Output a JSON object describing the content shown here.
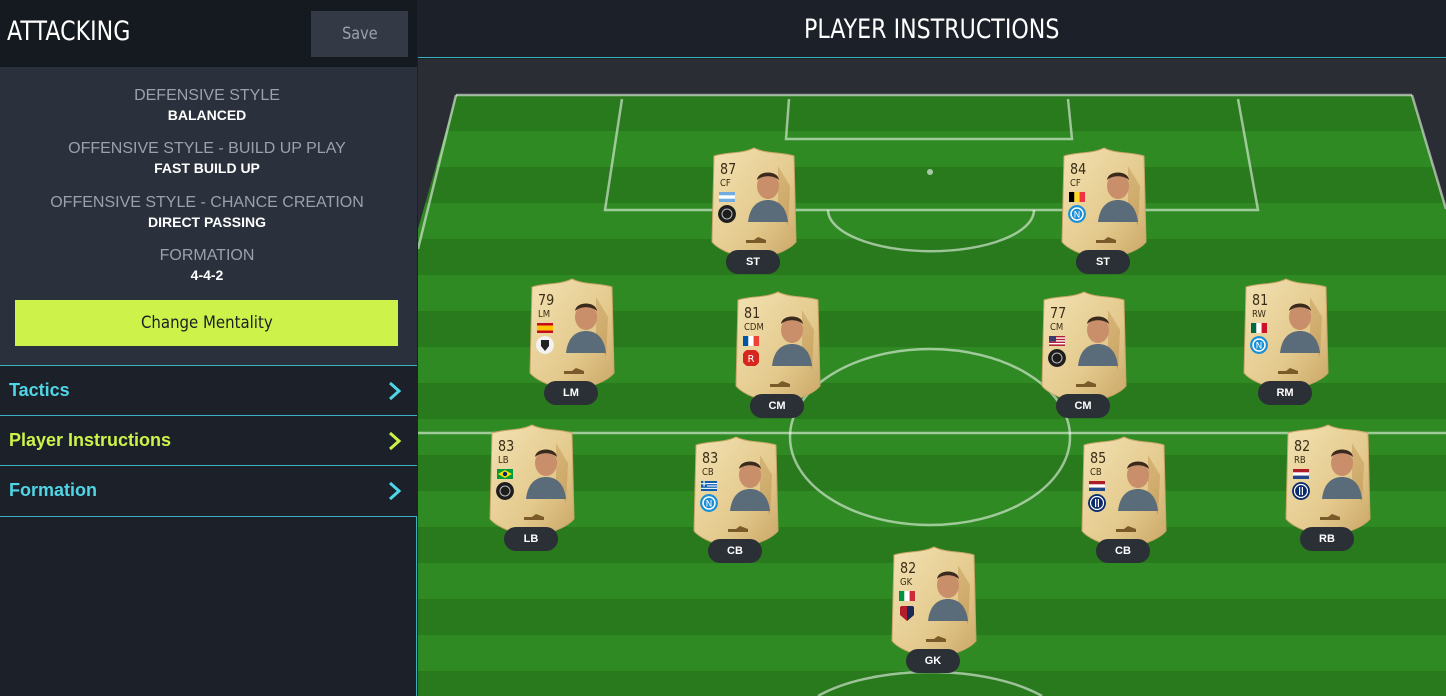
{
  "mentality": {
    "title": "ATTACKING",
    "save_label": "Save"
  },
  "styles": {
    "defensive_label": "DEFENSIVE STYLE",
    "defensive_value": "BALANCED",
    "buildup_label": "OFFENSIVE STYLE - BUILD UP PLAY",
    "buildup_value": "FAST BUILD UP",
    "chance_label": "OFFENSIVE STYLE - CHANCE CREATION",
    "chance_value": "DIRECT PASSING",
    "formation_label": "FORMATION",
    "formation_value": "4-4-2"
  },
  "change_mentality_label": "Change Mentality",
  "nav": {
    "items": [
      {
        "label": "Tactics",
        "color": "#4fd6e6",
        "active": false
      },
      {
        "label": "Player Instructions",
        "color": "#cdf34a",
        "active": true
      },
      {
        "label": "Formation",
        "color": "#4fd6e6",
        "active": false
      }
    ]
  },
  "header": {
    "title": "PLAYER INSTRUCTIONS"
  },
  "players": [
    {
      "rating": "87",
      "pos": "CF",
      "slot": "ST",
      "flag": "argentina",
      "club": "generic"
    },
    {
      "rating": "84",
      "pos": "CF",
      "slot": "ST",
      "flag": "belgium",
      "club": "napoli"
    },
    {
      "rating": "79",
      "pos": "LM",
      "slot": "LM",
      "flag": "spain",
      "club": "udinese"
    },
    {
      "rating": "81",
      "pos": "CDM",
      "slot": "CM",
      "flag": "france",
      "club": "reims"
    },
    {
      "rating": "77",
      "pos": "CM",
      "slot": "CM",
      "flag": "usa",
      "club": "generic"
    },
    {
      "rating": "81",
      "pos": "RW",
      "slot": "RM",
      "flag": "mexico",
      "club": "napoli"
    },
    {
      "rating": "83",
      "pos": "LB",
      "slot": "LB",
      "flag": "brazil",
      "club": "generic"
    },
    {
      "rating": "83",
      "pos": "CB",
      "slot": "CB",
      "flag": "greece",
      "club": "napoli"
    },
    {
      "rating": "85",
      "pos": "CB",
      "slot": "CB",
      "flag": "netherlands",
      "club": "inter"
    },
    {
      "rating": "82",
      "pos": "RB",
      "slot": "RB",
      "flag": "netherlands",
      "club": "inter"
    },
    {
      "rating": "82",
      "pos": "GK",
      "slot": "GK",
      "flag": "italy",
      "club": "genoa"
    }
  ],
  "colors": {
    "accent": "#cdf34a",
    "link": "#4fd6e6",
    "divider": "#3ab0c0"
  }
}
